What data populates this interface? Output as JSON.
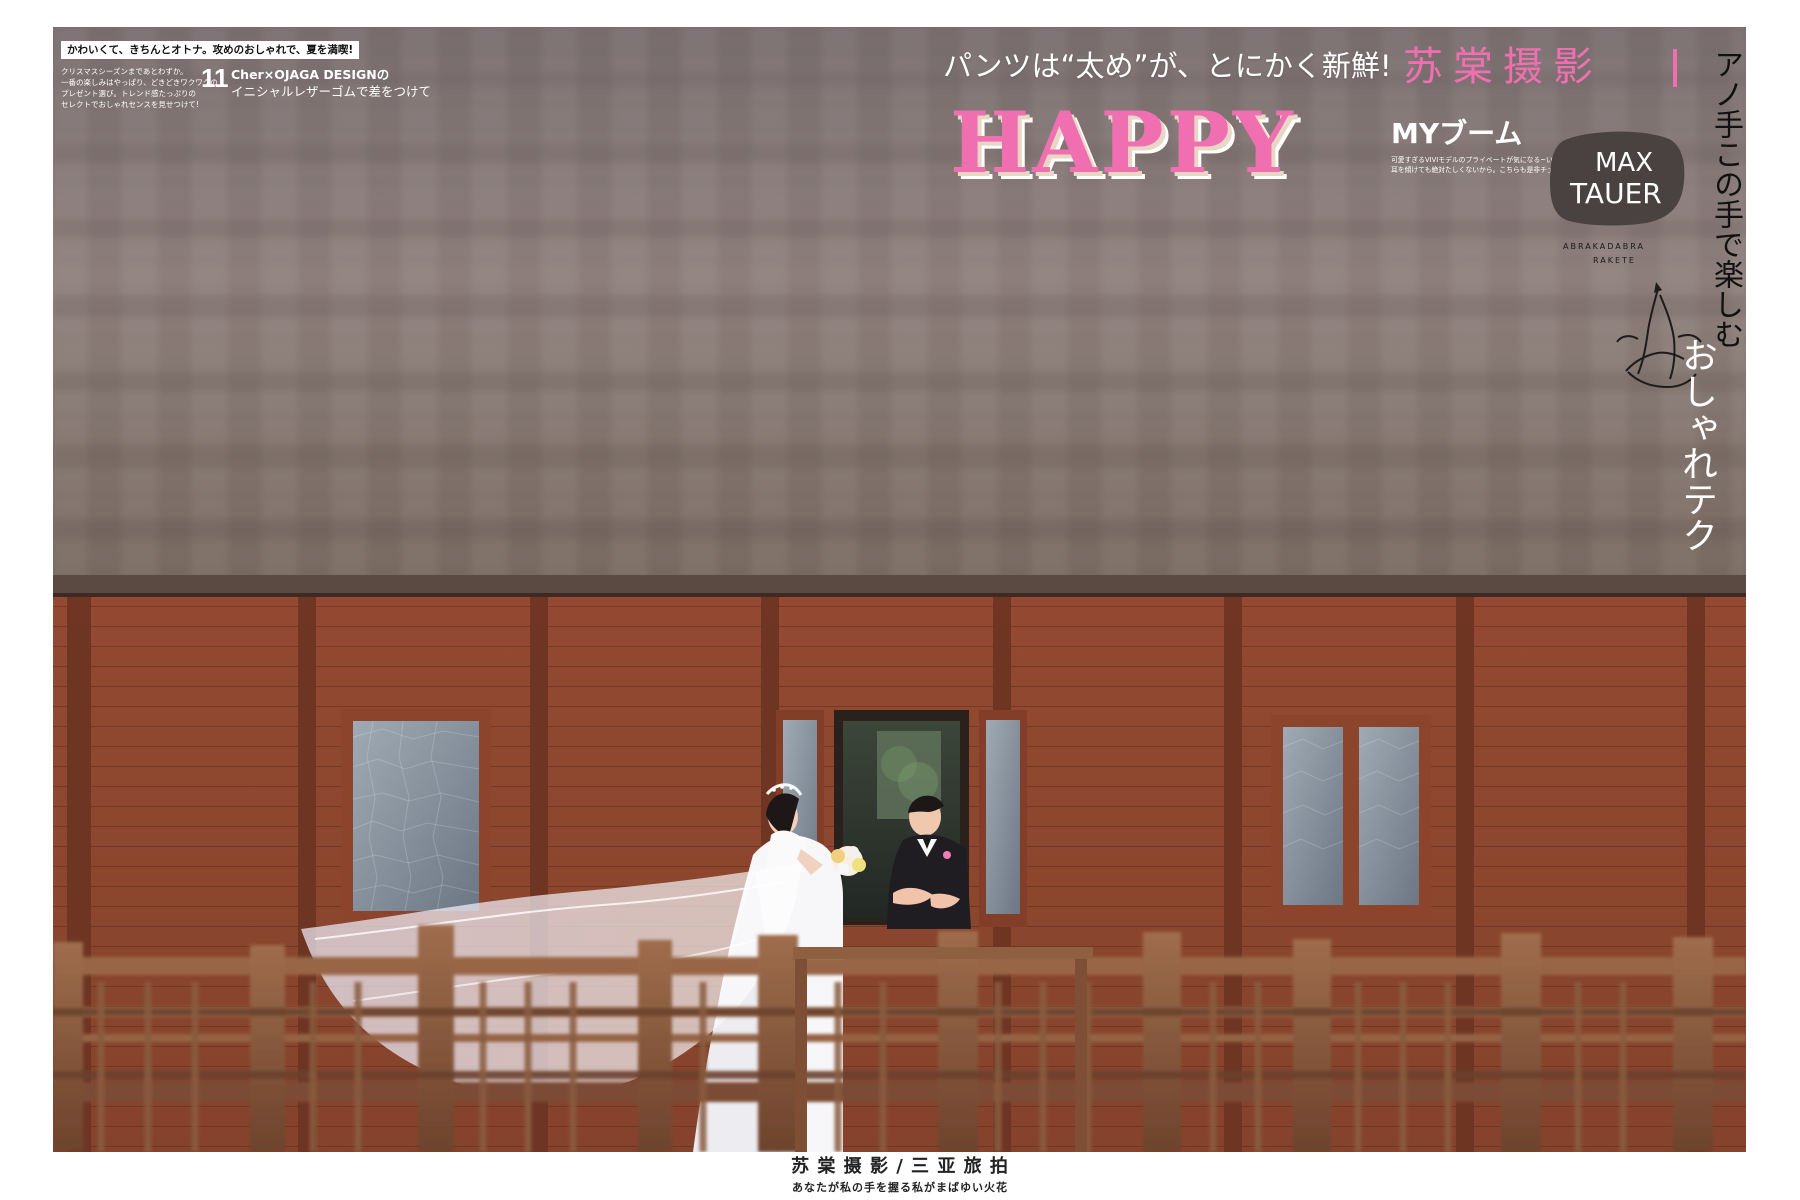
{
  "header": {
    "tag": "かわいくて、きちんとオトナ。攻めのおしゃれで、夏を満喫!",
    "small_copy": [
      "クリスマスシーズンまであとわずか。",
      "一番の楽しみはやっぱり、どきどきワクワクの",
      "プレゼント選び。トレンド感たっぷりの",
      "セレクトでおしゃれセンスを見せつけて!"
    ],
    "number": "11",
    "brand_line_1": "Cher×OJAGA DESIGNの",
    "brand_line_2": "イニシャルレザーゴムで差をつけて"
  },
  "title": {
    "headline_jp": "パンツは“太め”が、とにかく新鮮!",
    "studio": "苏棠摄影",
    "happy": "HAPPY",
    "my_boom": "MYブーム",
    "tiny_notes": [
      "可愛すぎるVIVIモデルのプライベートが気になる~い!  そんな声に",
      "耳を傾けても絶対たしくないから。こちらも是非チェック・チェック!!"
    ],
    "vertical_1": "アノ手この手で楽しむ",
    "vertical_2": "おしゃれテク"
  },
  "badge": {
    "line_1": "MAX",
    "line_2": "TAUER",
    "caption_1": "ABRAKADABRA",
    "caption_2": "RAKETE"
  },
  "footer": {
    "main": "苏  棠  摄  影 / 三 亚 旅 拍",
    "sub": "あなたが私の手を握る私がまばゆい火花"
  },
  "colors": {
    "pink": "#f06fb1",
    "roof": "#8f7e79",
    "wood": "#9a4b31",
    "rail": "#8e5a3c"
  }
}
